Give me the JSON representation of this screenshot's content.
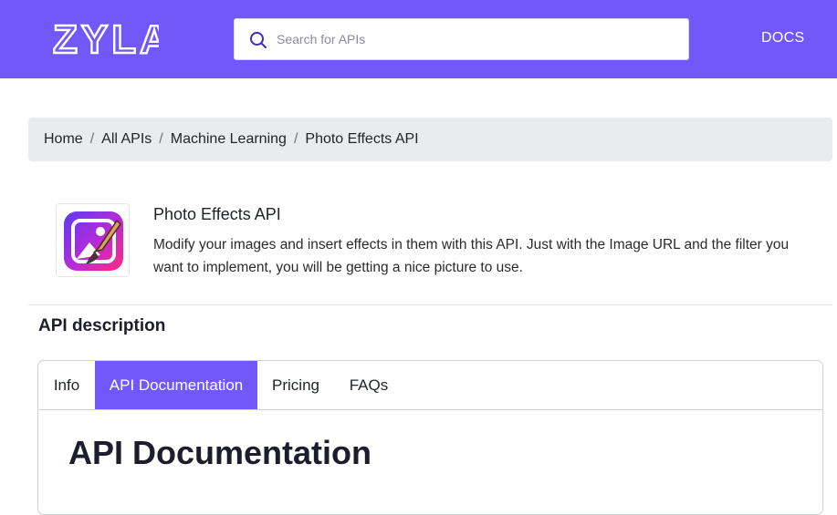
{
  "header": {
    "logo_text": "ZYLA",
    "docs_label": "DOCS",
    "brand_color": "#7358f9"
  },
  "search": {
    "placeholder": "Search for APIs",
    "value": ""
  },
  "breadcrumb": {
    "items": [
      "Home",
      "All APIs",
      "Machine Learning",
      "Photo Effects API"
    ],
    "separator": "/"
  },
  "api": {
    "title": "Photo Effects API",
    "description": "Modify your images and insert effects in them with this API. Just with the Image URL and the filter you want to implement, you will be getting a nice picture to use.",
    "icon": "photo-effects-icon"
  },
  "section": {
    "title": "API description"
  },
  "tabs": [
    {
      "label": "Info",
      "active": false
    },
    {
      "label": "API Documentation",
      "active": true
    },
    {
      "label": "Pricing",
      "active": false
    },
    {
      "label": "FAQs",
      "active": false
    }
  ],
  "content": {
    "heading": "API Documentation"
  }
}
